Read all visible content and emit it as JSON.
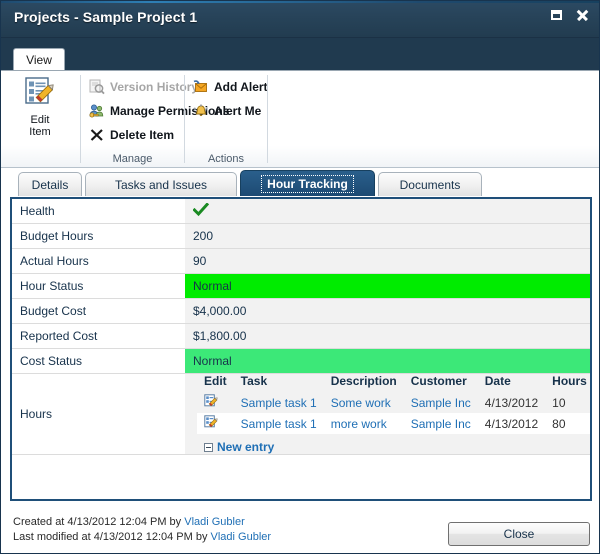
{
  "window": {
    "title": "Projects - Sample Project 1",
    "buttons": {
      "restore": "restore",
      "close": "close"
    }
  },
  "ribbon": {
    "tab_label": "View",
    "big_button": {
      "line1": "Edit",
      "line2": "Item"
    },
    "groups": [
      {
        "label": "Manage",
        "commands": [
          {
            "label": "Version History",
            "icon": "version-history-icon",
            "disabled": true
          },
          {
            "label": "Manage Permissions",
            "icon": "manage-permissions-icon",
            "disabled": false
          },
          {
            "label": "Delete Item",
            "icon": "delete-item-icon",
            "disabled": false
          }
        ]
      },
      {
        "label": "Actions",
        "commands": [
          {
            "label": "Add Alert",
            "icon": "add-alert-icon",
            "disabled": false
          },
          {
            "label": "Alert Me",
            "icon": "alert-me-icon",
            "disabled": false
          }
        ]
      }
    ]
  },
  "tabs": [
    {
      "label": "Details",
      "active": false
    },
    {
      "label": "Tasks and Issues",
      "active": false
    },
    {
      "label": "Hour Tracking",
      "active": true
    },
    {
      "label": "Documents",
      "active": false
    }
  ],
  "fields": [
    {
      "label": "Health",
      "value": "",
      "type": "check"
    },
    {
      "label": "Budget Hours",
      "value": "200",
      "type": "text"
    },
    {
      "label": "Actual Hours",
      "value": "90",
      "type": "text"
    },
    {
      "label": "Hour Status",
      "value": "Normal",
      "type": "status",
      "color": "#00ec00"
    },
    {
      "label": "Budget Cost",
      "value": "$4,000.00",
      "type": "text"
    },
    {
      "label": "Reported Cost",
      "value": "$1,800.00",
      "type": "text"
    },
    {
      "label": "Cost Status",
      "value": "Normal",
      "type": "status",
      "color": "#3ce878"
    },
    {
      "label": "Hours",
      "value": "",
      "type": "grid"
    }
  ],
  "hours_grid": {
    "columns": [
      "Edit",
      "Task",
      "Description",
      "Customer",
      "Date",
      "Hours"
    ],
    "rows": [
      {
        "task": "Sample task 1",
        "description": "Some work",
        "customer": "Sample Inc",
        "date": "4/13/2012",
        "hours": "10"
      },
      {
        "task": "Sample task 1",
        "description": "more work",
        "customer": "Sample Inc",
        "date": "4/13/2012",
        "hours": "80"
      }
    ],
    "new_entry_label": "New entry"
  },
  "footer": {
    "created_prefix": "Created at 4/13/2012 12:04 PM by ",
    "created_user": "Vladi Gubler",
    "modified_prefix": "Last modified at 4/13/2012 12:04 PM by ",
    "modified_user": "Vladi Gubler",
    "close_label": "Close"
  }
}
